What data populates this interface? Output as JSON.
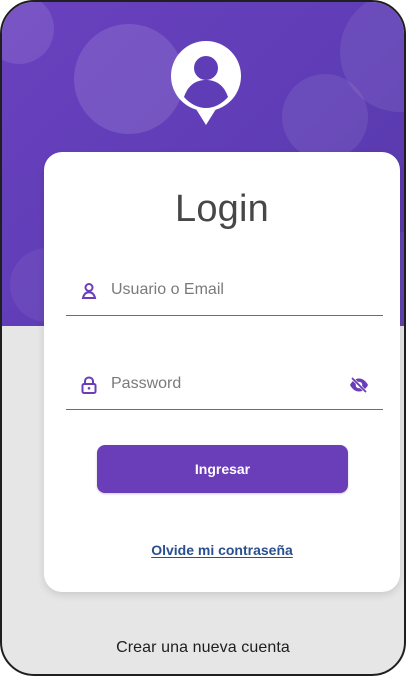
{
  "colors": {
    "primary": "#6a3db9",
    "header_gradient_start": "#6a41bf",
    "header_gradient_end": "#5738a8",
    "background": "#e6e6e6",
    "card": "#ffffff",
    "link": "#294f8e"
  },
  "header": {
    "icon": "user-avatar-icon"
  },
  "card": {
    "title": "Login",
    "user_field": {
      "icon": "user-icon",
      "placeholder": "Usuario o Email",
      "value": ""
    },
    "password_field": {
      "icon": "lock-icon",
      "placeholder": "Password",
      "value": "",
      "toggle_icon": "eye-off-icon"
    },
    "login_button_label": "Ingresar",
    "forgot_password_label": "Olvide mi contraseña"
  },
  "footer": {
    "create_account_label": "Crear una nueva cuenta"
  }
}
